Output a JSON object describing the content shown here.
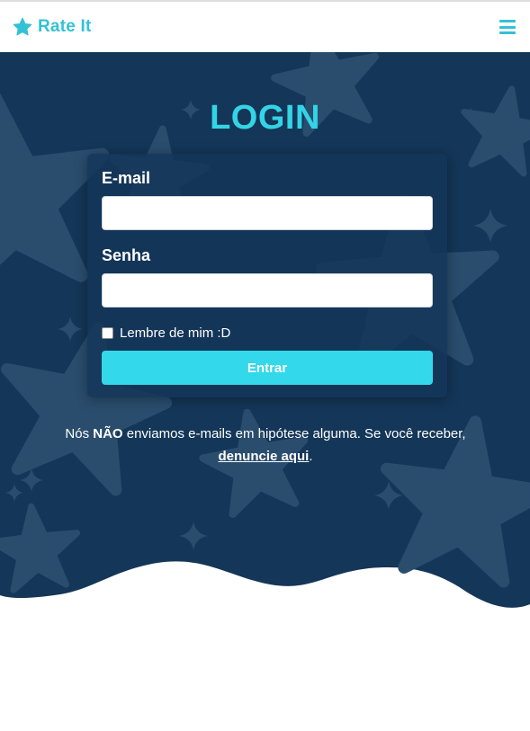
{
  "navbar": {
    "brand_icon": "star-icon",
    "brand_text": "Rate It",
    "menu_icon": "hamburger-menu-icon"
  },
  "login": {
    "title": "LOGIN",
    "email_label": "E-mail",
    "email_value": "",
    "password_label": "Senha",
    "password_value": "",
    "remember_label": "Lembre de mim :D",
    "remember_checked": false,
    "submit_label": "Entrar"
  },
  "notice": {
    "prefix": "Nós ",
    "strong": "NÃO",
    "middle": " enviamos e-mails em hipótese alguma. Se você receber, ",
    "link_text": "denuncie aqui",
    "suffix": "."
  },
  "colors": {
    "accent": "#33c1d6",
    "button": "#33d8ea",
    "hero_background": "#143658",
    "star_shape": "#2a4d6e"
  }
}
